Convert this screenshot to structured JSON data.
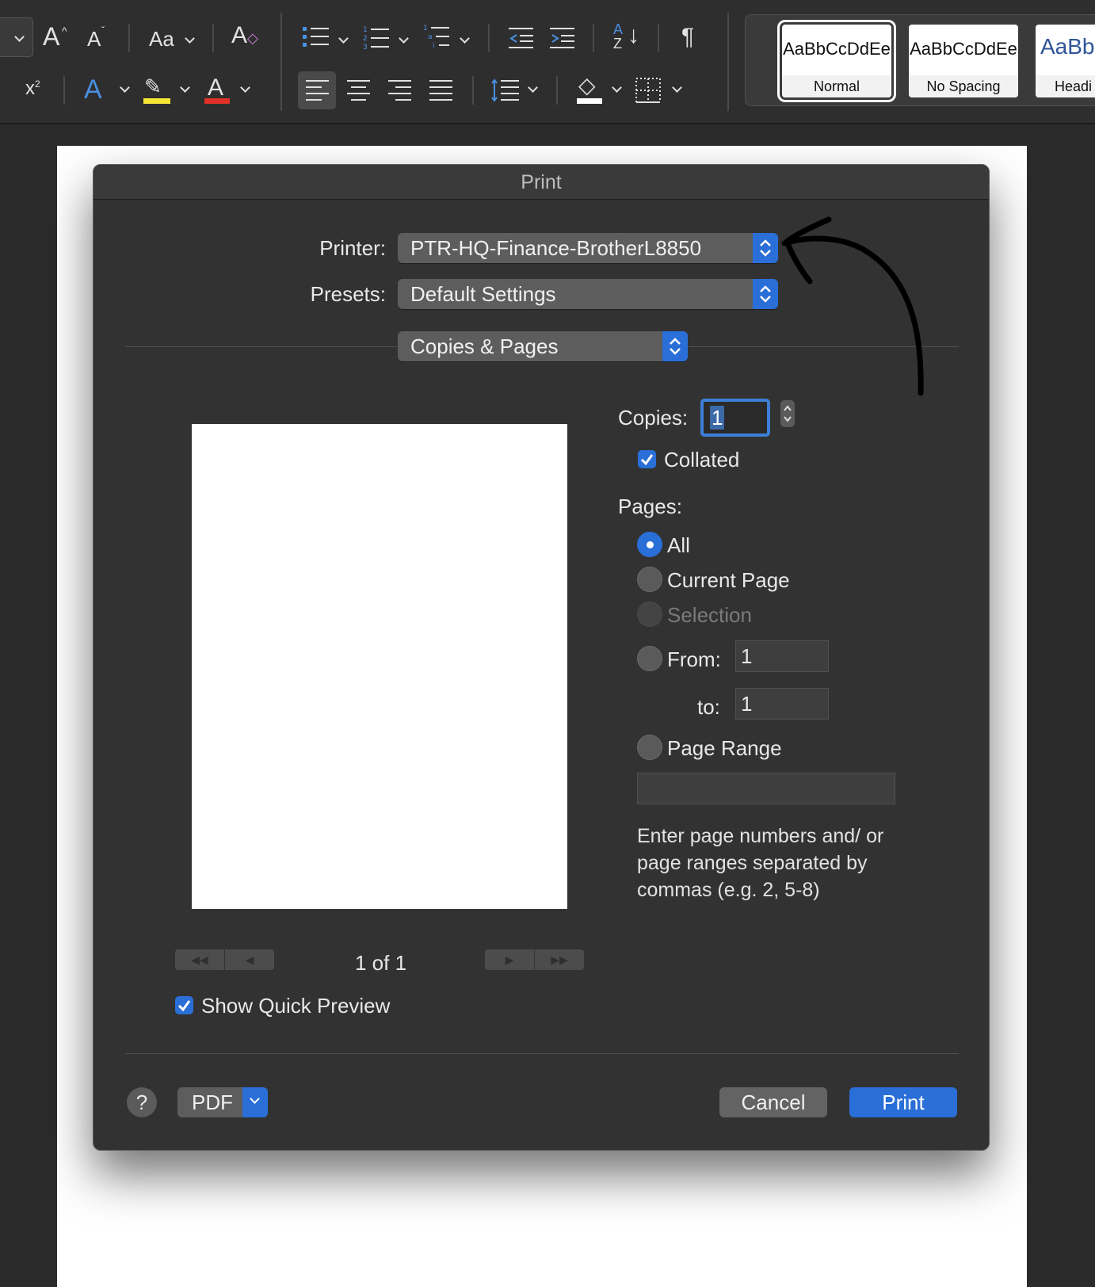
{
  "ribbon": {
    "font_grow": "A",
    "font_shrink": "A",
    "change_case": "Aa",
    "superscript": "x",
    "superscript_exp": "2",
    "text_effects": "A",
    "font_color": "A",
    "sort": "A",
    "sort_to": "Z",
    "pilcrow": "¶",
    "highlight_color": "#f5e534",
    "font_color_value": "#e0312b",
    "styles": [
      {
        "sample": "AaBbCcDdEe",
        "name": "Normal",
        "selected": true
      },
      {
        "sample": "AaBbCcDdEe",
        "name": "No Spacing",
        "selected": false
      },
      {
        "sample": "AaBbCc",
        "name": "Headi",
        "selected": false
      }
    ]
  },
  "dialog": {
    "title": "Print",
    "printer_label": "Printer:",
    "printer_value": "PTR-HQ-Finance-BrotherL8850",
    "presets_label": "Presets:",
    "presets_value": "Default Settings",
    "section_value": "Copies & Pages",
    "copies_label": "Copies:",
    "copies_value": "1",
    "collated_label": "Collated",
    "collated_checked": true,
    "pages_label": "Pages:",
    "pages_options": {
      "all": "All",
      "current": "Current Page",
      "selection": "Selection",
      "from": "From:",
      "to": "to:",
      "page_range": "Page Range"
    },
    "pages_selected": "All",
    "from_value": "1",
    "to_value": "1",
    "page_range_value": "",
    "help_text": "Enter page numbers and/ or page ranges separated by commas (e.g. 2, 5-8)",
    "page_counter": "1 of 1",
    "show_quick_preview_label": "Show Quick Preview",
    "show_quick_preview_checked": true,
    "help_button": "?",
    "pdf_label": "PDF",
    "cancel_label": "Cancel",
    "print_label": "Print",
    "accent": "#2a6fd8"
  }
}
